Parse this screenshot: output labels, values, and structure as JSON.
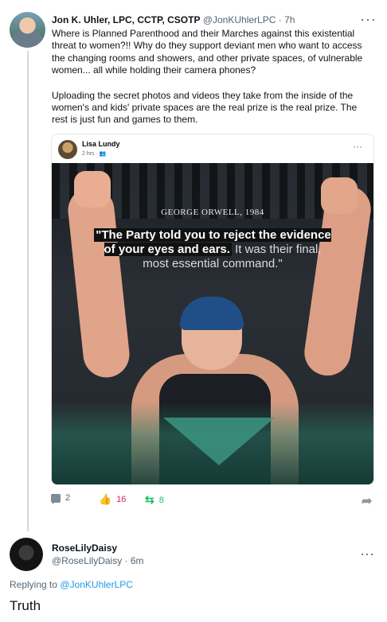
{
  "post": {
    "author_name": "Jon K. Uhler, LPC, CCTP, CSOTP",
    "author_handle": "@JonKUhlerLPC",
    "time": "7h",
    "paragraph1": "Where is Planned Parenthood and their Marches against this existential threat to women?!!  Why do they support deviant men who want to access the changing rooms and showers, and other private spaces, of vulnerable women... all while holding their camera phones?",
    "paragraph2": "Uploading the secret photos and videos they take from the inside of the women's and kids' private spaces are the real prize is the real prize. The rest is just fun and games to them."
  },
  "card": {
    "author": "Lisa Lundy",
    "meta": "2 hrs · ",
    "more": "···",
    "quote_source": "GEORGE ORWELL, 1984",
    "quote_bold": "\"The Party told you to reject the evidence of your eyes and ears.",
    "quote_rest": " It was their final, most essential command.\""
  },
  "actions": {
    "replies": "2",
    "likes": "16",
    "reposts": "8",
    "icons": [
      "reply-icon",
      "like-icon",
      "repost-icon",
      "share-icon"
    ]
  },
  "reply": {
    "author_name": "RoseLilyDaisy",
    "author_handle": "@RoseLilyDaisy · 6m",
    "replying_prefix": "Replying to ",
    "replying_to": "@JonKUhlerLPC",
    "text": "Truth"
  },
  "colors": {
    "link": "#1d9bf0",
    "like": "#e0245e",
    "repost": "#17bf63"
  }
}
